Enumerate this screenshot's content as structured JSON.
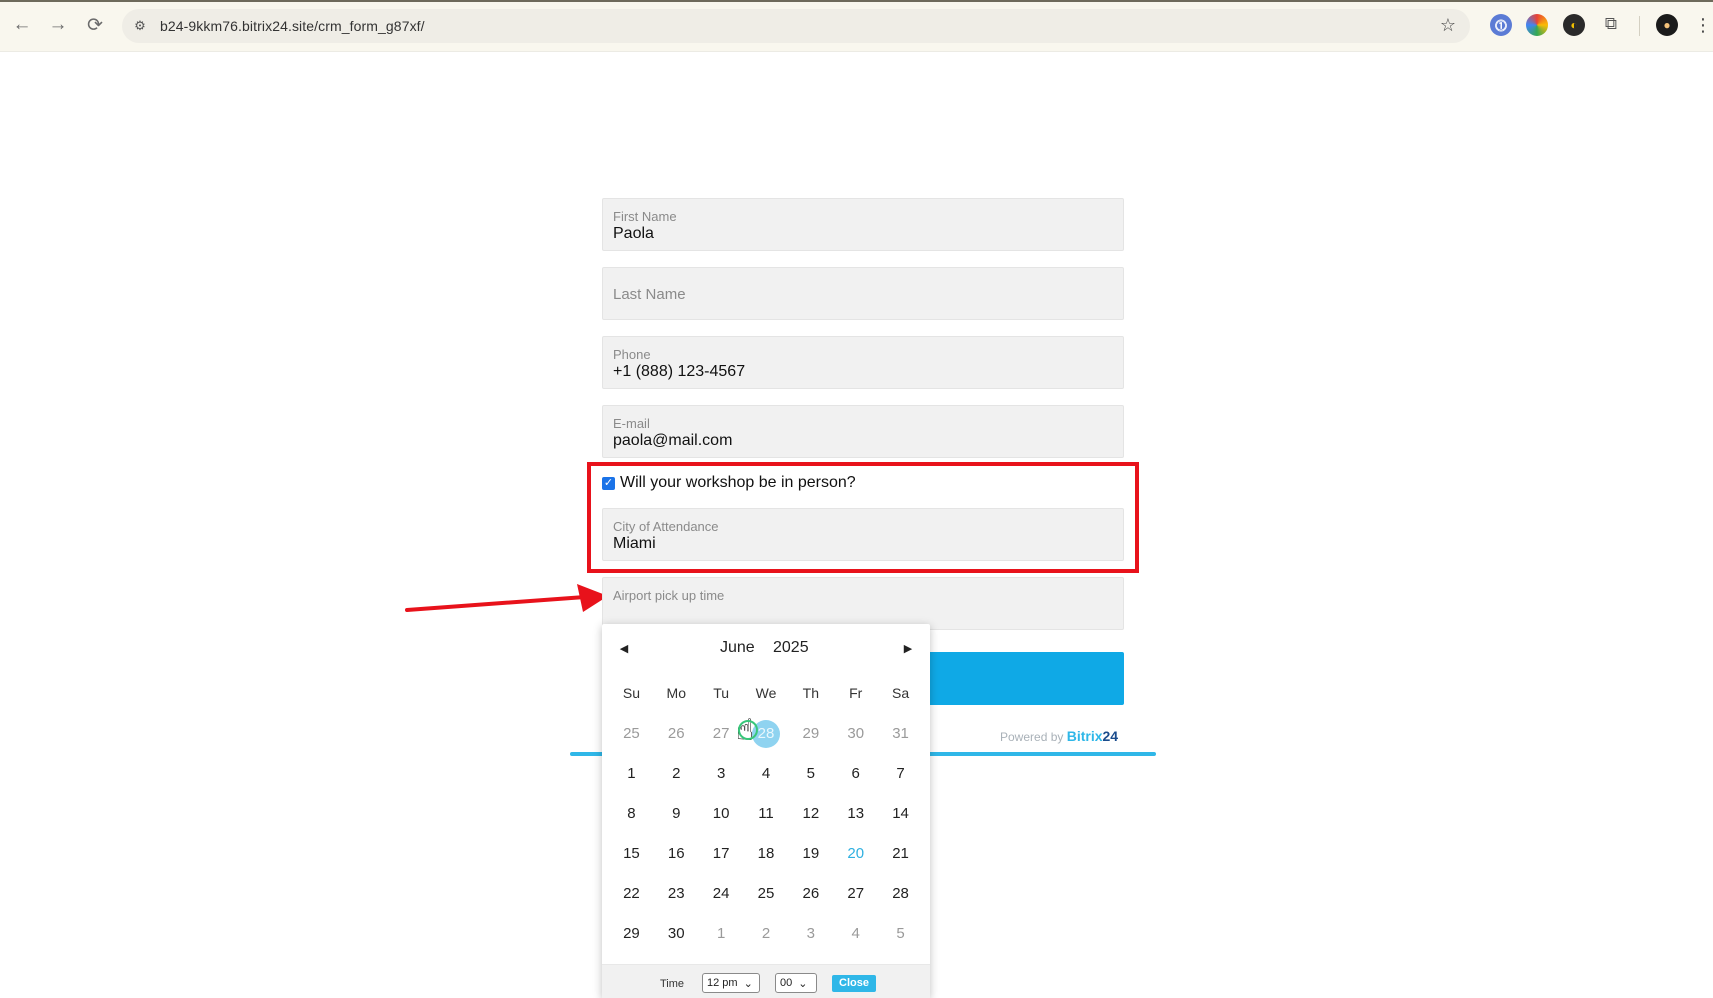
{
  "browser": {
    "url": "b24-9kkm76.bitrix24.site/crm_form_g87xf/",
    "back_icon": "arrow-left-icon",
    "forward_icon": "arrow-right-icon",
    "reload_icon": "reload-icon",
    "bookmark_icon": "star-icon"
  },
  "form": {
    "first_name": {
      "label": "First Name",
      "value": "Paola"
    },
    "last_name": {
      "placeholder": "Last Name"
    },
    "phone": {
      "label": "Phone",
      "value": "+1 (888) 123-4567"
    },
    "email": {
      "label": "E-mail",
      "value": "paola@mail.com"
    },
    "in_person": {
      "label": "Will your workshop be in person?",
      "checked": true
    },
    "city": {
      "label": "City of Attendance",
      "value": "Miami"
    },
    "pickup": {
      "label": "Airport pick up time"
    },
    "powered_prefix": "Powered by",
    "powered_brand": "Bitrix",
    "powered_brand_num": "24"
  },
  "calendar": {
    "month": "June",
    "year": "2025",
    "weekdays": [
      "Su",
      "Mo",
      "Tu",
      "We",
      "Th",
      "Fr",
      "Sa"
    ],
    "days": [
      {
        "d": "25",
        "other": true
      },
      {
        "d": "26",
        "other": true
      },
      {
        "d": "27",
        "other": true
      },
      {
        "d": "28",
        "other": true,
        "selected": true
      },
      {
        "d": "29",
        "other": true
      },
      {
        "d": "30",
        "other": true
      },
      {
        "d": "31",
        "other": true
      },
      {
        "d": "1"
      },
      {
        "d": "2"
      },
      {
        "d": "3"
      },
      {
        "d": "4"
      },
      {
        "d": "5"
      },
      {
        "d": "6"
      },
      {
        "d": "7"
      },
      {
        "d": "8"
      },
      {
        "d": "9"
      },
      {
        "d": "10"
      },
      {
        "d": "11"
      },
      {
        "d": "12"
      },
      {
        "d": "13"
      },
      {
        "d": "14"
      },
      {
        "d": "15"
      },
      {
        "d": "16"
      },
      {
        "d": "17"
      },
      {
        "d": "18"
      },
      {
        "d": "19"
      },
      {
        "d": "20",
        "today": true
      },
      {
        "d": "21"
      },
      {
        "d": "22"
      },
      {
        "d": "23"
      },
      {
        "d": "24"
      },
      {
        "d": "25"
      },
      {
        "d": "26"
      },
      {
        "d": "27"
      },
      {
        "d": "28"
      },
      {
        "d": "29"
      },
      {
        "d": "30"
      },
      {
        "d": "1",
        "other": true
      },
      {
        "d": "2",
        "other": true
      },
      {
        "d": "3",
        "other": true
      },
      {
        "d": "4",
        "other": true
      },
      {
        "d": "5",
        "other": true
      }
    ],
    "time_label": "Time",
    "hour": "12 pm",
    "minute": "00",
    "close_label": "Close"
  },
  "colors": {
    "accent": "#0fa9e6",
    "highlight": "#e8121b",
    "today": "#2fb0e0"
  }
}
